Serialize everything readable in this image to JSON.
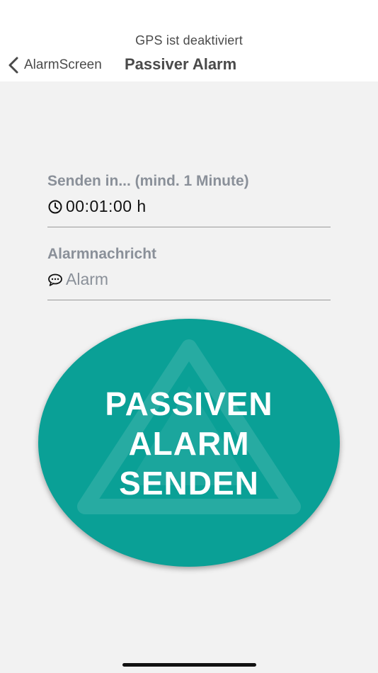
{
  "status": {
    "gps_text": "GPS ist deaktiviert"
  },
  "nav": {
    "back_label": "AlarmScreen",
    "title": "Passiver Alarm",
    "back_icon": "chevron-left-icon"
  },
  "form": {
    "time_field": {
      "label": "Senden in... (mind. 1 Minute)",
      "value": "00:01:00 h",
      "icon": "clock-icon"
    },
    "message_field": {
      "label": "Alarmnachricht",
      "value": "Alarm",
      "icon": "chat-bubble-icon"
    }
  },
  "alarm_button": {
    "line1": "PASSIVEN",
    "line2": "ALARM",
    "line3": "SENDEN",
    "color": "#0aa096",
    "watermark_icon": "triangle-logo-icon"
  },
  "colors": {
    "background": "#f2f2f2",
    "header": "#ffffff",
    "label_gray": "#8a9099",
    "accent": "#0aa096"
  }
}
